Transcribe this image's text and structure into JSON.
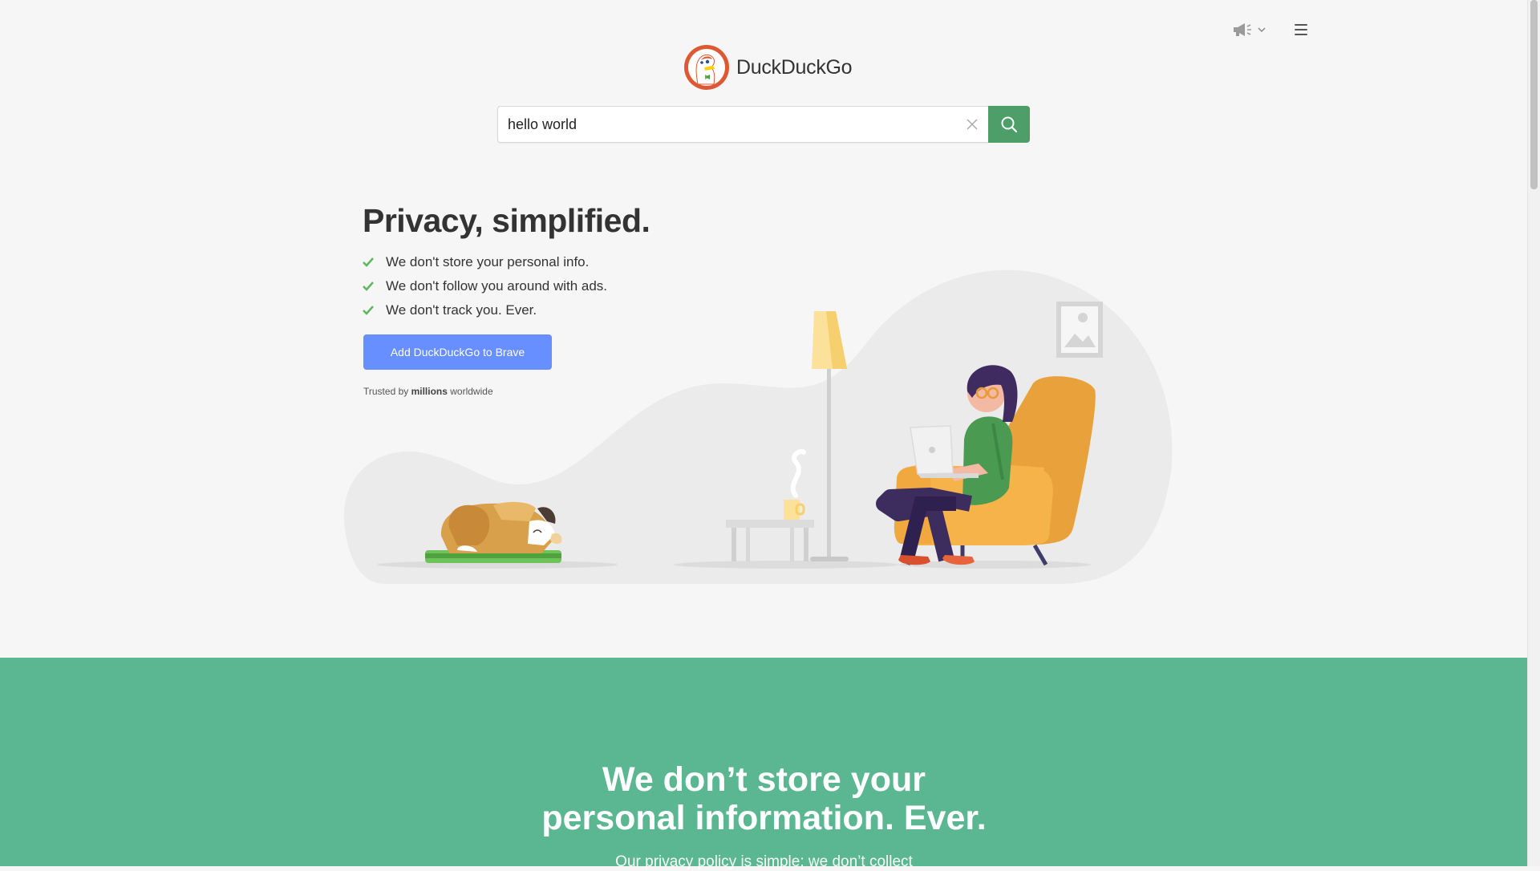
{
  "header": {
    "logo_text": "DuckDuckGo",
    "announcement_icon": "megaphone-icon",
    "menu_icon": "hamburger-menu-icon"
  },
  "search": {
    "value": "hello world",
    "clear_icon": "close-icon",
    "submit_icon": "search-icon"
  },
  "hero": {
    "title": "Privacy, simplified.",
    "features": [
      "We don't store your personal info.",
      "We don't follow you around with ads.",
      "We don't track you. Ever."
    ],
    "cta_label": "Add DuckDuckGo to Brave",
    "trusted_prefix": "Trusted by ",
    "trusted_bold": "millions",
    "trusted_suffix": " worldwide"
  },
  "section2": {
    "title_line1": "We don’t store your",
    "title_line2": "personal information. Ever.",
    "subtitle": "Our privacy policy is simple: we don’t collect"
  },
  "colors": {
    "accent_green": "#4e9e69",
    "cta_blue": "#678fff",
    "section_green": "#5bb791",
    "check_green": "#5cb85c"
  }
}
